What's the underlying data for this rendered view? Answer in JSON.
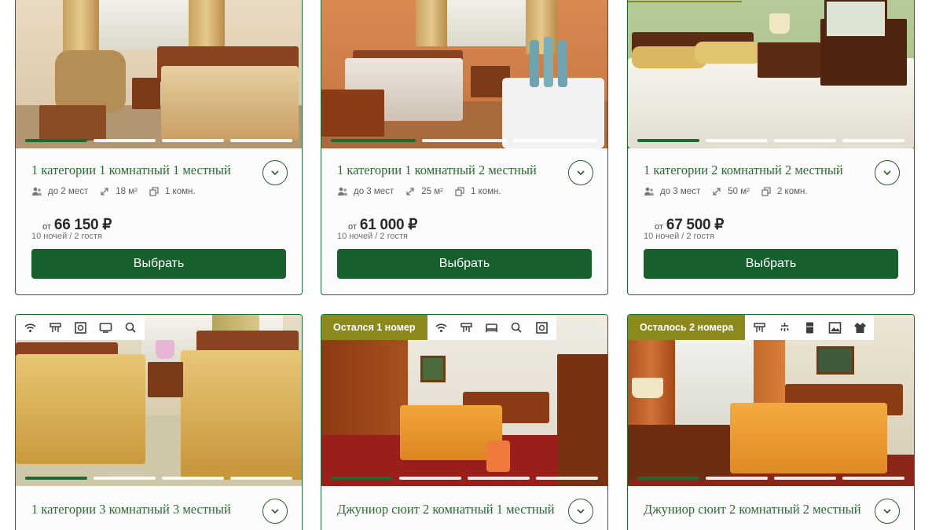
{
  "colors": {
    "accent": "#175f2c",
    "title": "#2b6b33",
    "badge": "#8c8a1d",
    "border": "#1e6b32"
  },
  "cards_top": [
    {
      "title": "1 категории 1 комнатный 1 местный",
      "guests": "до 2 мест",
      "area": "18 м²",
      "rooms": "1 комн.",
      "price_from": "от",
      "price": "66 150 ₽",
      "nights": "10 ночей / 2 гостя",
      "button": "Выбрать"
    },
    {
      "title": "1 категории 1 комнатный 2 местный",
      "guests": "до 3 мест",
      "area": "25 м²",
      "rooms": "1 комн.",
      "price_from": "от",
      "price": "61 000 ₽",
      "nights": "10 ночей / 2 гостя",
      "button": "Выбрать"
    },
    {
      "title": "1 категории 2 комнатный 2 местный",
      "guests": "до 3 мест",
      "area": "50 м²",
      "rooms": "2 комн.",
      "price_from": "от",
      "price": "67 500 ₽",
      "nights": "10 ночей / 2 гостя",
      "button": "Выбрать"
    }
  ],
  "cards_bottom": [
    {
      "badge": "",
      "amenity_icons": [
        "wifi-icon",
        "hairdryer-icon",
        "safe-icon",
        "tv-icon",
        "kettle-icon"
      ],
      "title": "1 категории 3 комнатный 3 местный"
    },
    {
      "badge": "Остался 1 номер",
      "amenity_icons": [
        "wifi-icon",
        "hairdryer-icon",
        "bed-icon",
        "kettle-icon",
        "safe-icon"
      ],
      "title": "Джуниор сюит 2 комнатный 1 местный"
    },
    {
      "badge": "Осталось 2 номера",
      "amenity_icons": [
        "hairdryer-icon",
        "shower-icon",
        "fridge-icon",
        "picture-icon",
        "bathrobe-icon"
      ],
      "title": "Джуниор сюит 2 комнатный 2 местный"
    }
  ]
}
